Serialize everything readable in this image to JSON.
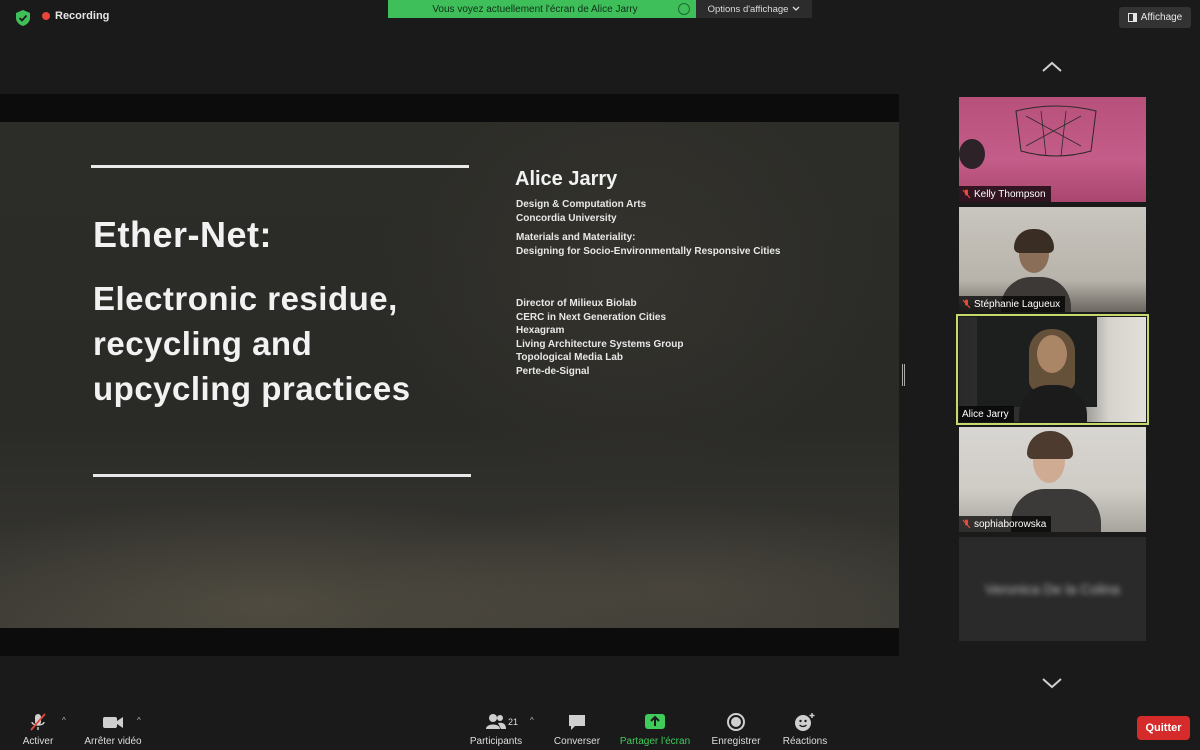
{
  "top_bar": {
    "recording_label": "Recording",
    "banner_text": "Vous voyez actuellement l'écran de Alice Jarry",
    "view_options_label": "Options d'affichage",
    "view_button_label": "Affichage"
  },
  "slide": {
    "title_line1": "Ether-Net:",
    "title_lines": [
      "Electronic residue,",
      "recycling and",
      "upcycling practices"
    ],
    "author": "Alice Jarry",
    "affiliation": [
      "Design & Computation Arts",
      "Concordia University"
    ],
    "project": [
      "Materials and Materiality:",
      "Designing for Socio-Environmentally Responsive Cities"
    ],
    "roles": [
      "Director of Milieux Biolab",
      "CERC in Next Generation Cities",
      "Hexagram",
      "Living Architecture Systems Group",
      "Topological Media Lab",
      "Perte-de-Signal"
    ]
  },
  "participants": [
    {
      "name": "Kelly Thompson",
      "muted": true
    },
    {
      "name": "Stéphanie Lagueux",
      "muted": true
    },
    {
      "name": "Alice Jarry",
      "muted": false,
      "active_speaker": true
    },
    {
      "name": "sophiaborowska",
      "muted": true
    },
    {
      "name": "Veronica De la Colina",
      "video_off": true
    }
  ],
  "toolbar": {
    "mute_label": "Activer",
    "video_label": "Arrêter vidéo",
    "participants_label": "Participants",
    "participants_count": "21",
    "chat_label": "Converser",
    "share_label": "Partager l'écran",
    "record_label": "Enregistrer",
    "reactions_label": "Réactions",
    "quit_label": "Quitter"
  },
  "colors": {
    "banner_green": "#3fbf5a",
    "share_green": "#3fcc5b",
    "quit_red": "#d52b2b",
    "active_speaker_border": "#c6d96c",
    "recording_dot": "#e8453c"
  },
  "icons": [
    "shield-check-icon",
    "recording-dot-icon",
    "chevron-down-icon",
    "view-layout-icon",
    "chevron-up-icon",
    "mic-off-icon",
    "video-camera-icon",
    "participants-icon",
    "chat-icon",
    "share-screen-icon",
    "record-icon",
    "reactions-icon"
  ]
}
